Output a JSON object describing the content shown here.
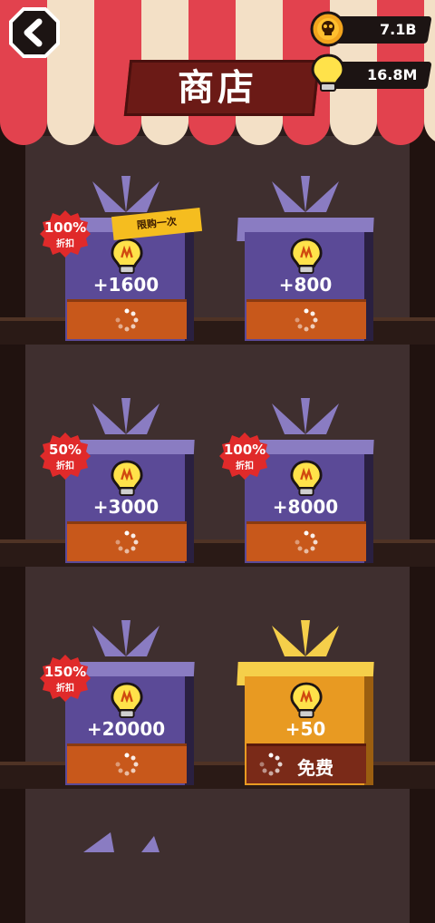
{
  "header": {
    "title": "商店",
    "back_icon": "back-arrow-icon",
    "currencies": [
      {
        "name": "skull-coin",
        "icon": "skull-coin-icon",
        "value": "7.1B"
      },
      {
        "name": "hint-bulb",
        "icon": "lightbulb-icon",
        "value": "16.8M"
      }
    ]
  },
  "shop": {
    "items": [
      {
        "amount": "+1600",
        "discount": "100%",
        "discount_sub": "折扣",
        "limit": "限购一次",
        "button": "loading"
      },
      {
        "amount": "+800",
        "discount": "",
        "discount_sub": "",
        "limit": "",
        "button": "loading"
      },
      {
        "amount": "+3000",
        "discount": "50%",
        "discount_sub": "折扣",
        "limit": "",
        "button": "loading"
      },
      {
        "amount": "+8000",
        "discount": "100%",
        "discount_sub": "折扣",
        "limit": "",
        "button": "loading"
      },
      {
        "amount": "+20000",
        "discount": "150%",
        "discount_sub": "折扣",
        "limit": "",
        "button": "loading"
      },
      {
        "amount": "+50",
        "discount": "",
        "discount_sub": "",
        "limit": "",
        "button": "免费"
      }
    ]
  },
  "colors": {
    "awning_red": "#e2424e",
    "awning_cream": "#f3e0c6",
    "box_purple": "#5b4a97",
    "box_gold": "#e89a22",
    "band_orange": "#c8581b",
    "discount_red": "#e02a2a",
    "limit_yellow": "#f5bd1f"
  }
}
